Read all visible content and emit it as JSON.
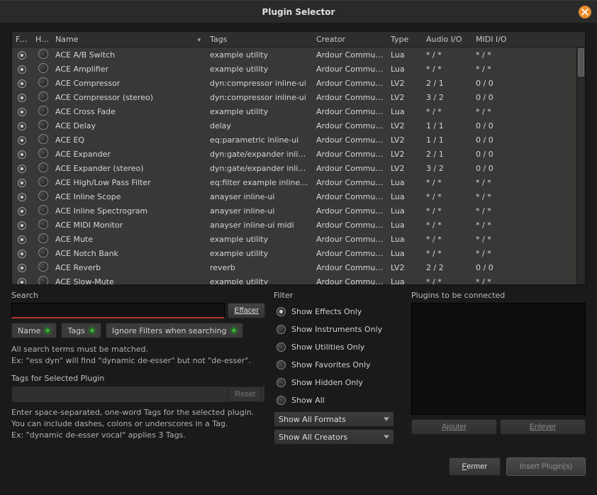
{
  "window": {
    "title": "Plugin Selector"
  },
  "columns": {
    "fav": "Fav",
    "hide": "Hide",
    "name": "Name",
    "tags": "Tags",
    "creator": "Creator",
    "type": "Type",
    "audio_io": "Audio I/O",
    "midi_io": "MIDI I/O"
  },
  "rows": [
    {
      "name": "ACE A/B Switch",
      "tags": "example utility",
      "creator": "Ardour Community",
      "type": "Lua",
      "audio": "* / *",
      "midi": "* / *"
    },
    {
      "name": "ACE Amplifier",
      "tags": "example utility",
      "creator": "Ardour Community",
      "type": "Lua",
      "audio": "* / *",
      "midi": "* / *"
    },
    {
      "name": "ACE Compressor",
      "tags": "dyn:compressor inline-ui",
      "creator": "Ardour Community",
      "type": "LV2",
      "audio": "2 / 1",
      "midi": "0 / 0"
    },
    {
      "name": "ACE Compressor (stereo)",
      "tags": "dyn:compressor inline-ui",
      "creator": "Ardour Community",
      "type": "LV2",
      "audio": "3 / 2",
      "midi": "0 / 0"
    },
    {
      "name": "ACE Cross Fade",
      "tags": "example utility",
      "creator": "Ardour Community",
      "type": "Lua",
      "audio": "* / *",
      "midi": "* / *"
    },
    {
      "name": "ACE Delay",
      "tags": "delay",
      "creator": "Ardour Community",
      "type": "LV2",
      "audio": "1 / 1",
      "midi": "0 / 0"
    },
    {
      "name": "ACE EQ",
      "tags": "eq:parametric inline-ui",
      "creator": "Ardour Community",
      "type": "LV2",
      "audio": "1 / 1",
      "midi": "0 / 0"
    },
    {
      "name": "ACE Expander",
      "tags": "dyn:gate/expander inline-ui",
      "creator": "Ardour Community",
      "type": "LV2",
      "audio": "2 / 1",
      "midi": "0 / 0"
    },
    {
      "name": "ACE Expander (stereo)",
      "tags": "dyn:gate/expander inline-ui",
      "creator": "Ardour Community",
      "type": "LV2",
      "audio": "3 / 2",
      "midi": "0 / 0"
    },
    {
      "name": "ACE High/Low Pass Filter",
      "tags": "eq:filter example inline-ui",
      "creator": "Ardour Community",
      "type": "Lua",
      "audio": "* / *",
      "midi": "* / *"
    },
    {
      "name": "ACE Inline Scope",
      "tags": "anayser inline-ui",
      "creator": "Ardour Community",
      "type": "Lua",
      "audio": "* / *",
      "midi": "* / *"
    },
    {
      "name": "ACE Inline Spectrogram",
      "tags": "anayser inline-ui",
      "creator": "Ardour Community",
      "type": "Lua",
      "audio": "* / *",
      "midi": "* / *"
    },
    {
      "name": "ACE MIDI Monitor",
      "tags": "anayser inline-ui midi",
      "creator": "Ardour Community",
      "type": "Lua",
      "audio": "* / *",
      "midi": "* / *"
    },
    {
      "name": "ACE Mute",
      "tags": "example utility",
      "creator": "Ardour Community",
      "type": "Lua",
      "audio": "* / *",
      "midi": "* / *"
    },
    {
      "name": "ACE Notch Bank",
      "tags": "example utility",
      "creator": "Ardour Community",
      "type": "Lua",
      "audio": "* / *",
      "midi": "* / *"
    },
    {
      "name": "ACE Reverb",
      "tags": "reverb",
      "creator": "Ardour Community",
      "type": "LV2",
      "audio": "2 / 2",
      "midi": "0 / 0"
    },
    {
      "name": "ACE Slow-Mute",
      "tags": "example utility",
      "creator": "Ardour Community",
      "type": "Lua",
      "audio": "* / *",
      "midi": "* / *"
    }
  ],
  "search": {
    "label": "Search",
    "clear": "Effacer",
    "toggle_name": "Name",
    "toggle_tags": "Tags",
    "toggle_ignore": "Ignore Filters when searching",
    "help1": "All search terms must be matched.",
    "help2": "Ex: \"ess dyn\" will find \"dynamic de-esser\" but not \"de-esser\"."
  },
  "tags_panel": {
    "label": "Tags for Selected Plugin",
    "reset": "Reset",
    "help1": "Enter space-separated, one-word Tags for the selected plugin.",
    "help2": "You can include dashes, colons or underscores in a Tag.",
    "help3": "Ex: \"dynamic de-esser vocal\" applies 3 Tags."
  },
  "filter": {
    "label": "Filter",
    "effects": "Show Effects Only",
    "instruments": "Show Instruments Only",
    "utilities": "Show Utilities Only",
    "favorites": "Show Favorites Only",
    "hidden": "Show Hidden Only",
    "all": "Show All",
    "formats": "Show All Formats",
    "creators": "Show All Creators"
  },
  "connect": {
    "label": "Plugins to be connected",
    "add": "Ajouter",
    "remove": "Enlever"
  },
  "footer": {
    "close_pre": "F",
    "close_post": "ermer",
    "insert": "Insert Plugin(s)"
  }
}
